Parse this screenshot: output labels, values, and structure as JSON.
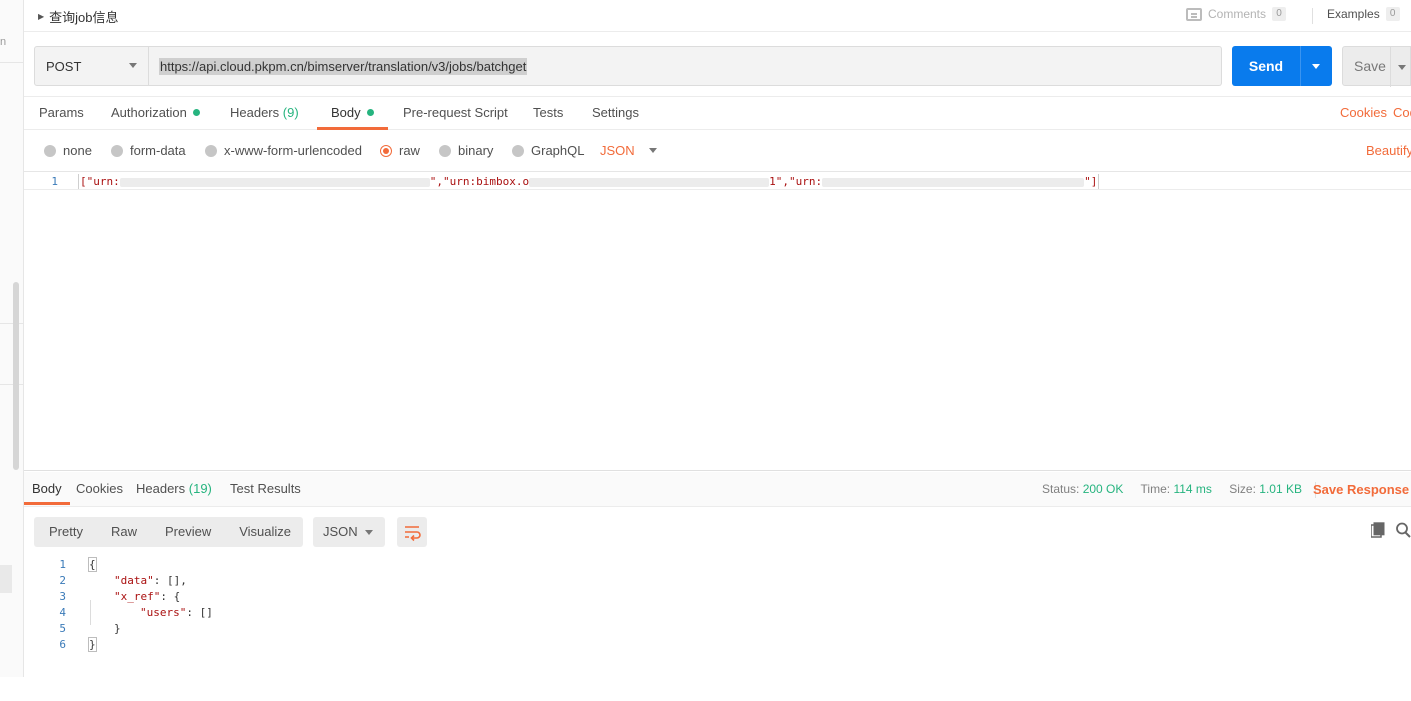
{
  "left_strip": {
    "fragment": "n"
  },
  "topbar": {
    "title": "查询job信息",
    "comments_label": "Comments",
    "comments_count": "0",
    "examples_label": "Examples",
    "examples_count": "0"
  },
  "request": {
    "method": "POST",
    "url": "https://api.cloud.pkpm.cn/bimserver/translation/v3/jobs/batchget",
    "send_label": "Send",
    "save_label": "Save"
  },
  "req_tabs": [
    {
      "label": "Params"
    },
    {
      "label": "Authorization"
    },
    {
      "label": "Headers",
      "count": "(9)"
    },
    {
      "label": "Body"
    },
    {
      "label": "Pre-request Script"
    },
    {
      "label": "Tests"
    },
    {
      "label": "Settings"
    }
  ],
  "req_links": {
    "cookies": "Cookies",
    "code": "Code"
  },
  "body_types": [
    "none",
    "form-data",
    "x-www-form-urlencoded",
    "raw",
    "binary",
    "GraphQL"
  ],
  "body_format": "JSON",
  "beautify_label": "Beautify",
  "request_body": {
    "line_number": "1",
    "seg1": "[\"urn:",
    "seg2": "\",\"urn:bimbox.o",
    "seg3": "1\",\"urn:",
    "seg4": "\"]"
  },
  "response_tabs": [
    {
      "label": "Body"
    },
    {
      "label": "Cookies"
    },
    {
      "label": "Headers",
      "count": "(19)"
    },
    {
      "label": "Test Results"
    }
  ],
  "response_status": {
    "status_label": "Status:",
    "status_value": "200 OK",
    "time_label": "Time:",
    "time_value": "114 ms",
    "size_label": "Size:",
    "size_value": "1.01 KB",
    "save_response": "Save Response"
  },
  "view_tabs": [
    "Pretty",
    "Raw",
    "Preview",
    "Visualize"
  ],
  "response_format": "JSON",
  "response_body": {
    "line_numbers": [
      "1",
      "2",
      "3",
      "4",
      "5",
      "6"
    ],
    "l1": "{",
    "l2_key": "\"data\"",
    "l2_rest": ": [],",
    "l3_key": "\"x_ref\"",
    "l3_rest": ": {",
    "l4_key": "\"users\"",
    "l4_rest": ": []",
    "l5": "}",
    "l6": "}"
  },
  "colors": {
    "accent": "#f26b3a",
    "send_blue": "#097bed",
    "success_green": "#26b47f"
  }
}
